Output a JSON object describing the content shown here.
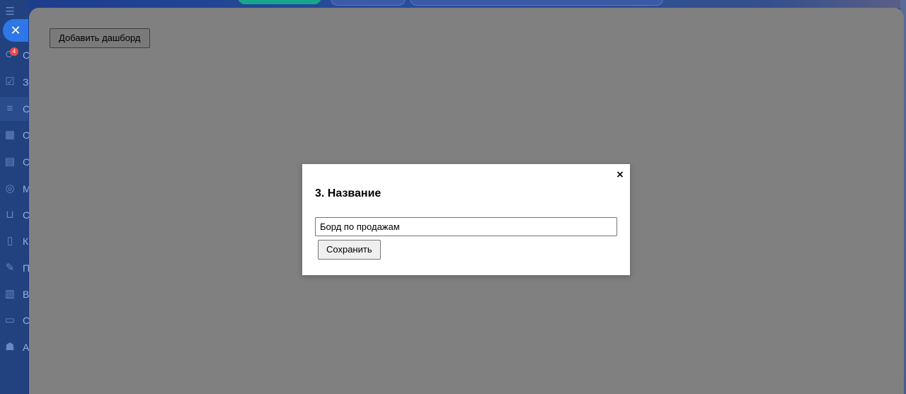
{
  "background_app": {
    "badge_count": "4",
    "sidebar_letters": [
      "С",
      "З",
      "С",
      "О",
      "С",
      "М",
      "С",
      "К",
      "П",
      "В",
      "С",
      "А"
    ],
    "sidebar_icons": [
      "pulse-icon",
      "checkbox-icon",
      "filter-icon",
      "calendar-icon",
      "inbox-icon",
      "target-icon",
      "cart-icon",
      "document-icon",
      "pen-icon",
      "chart-icon",
      "card-icon",
      "robot-icon"
    ]
  },
  "main": {
    "add_dashboard_label": "Добавить дашборд"
  },
  "modal": {
    "title": "3. Название",
    "close_glyph": "×",
    "name_value": "Борд по продажам",
    "save_label": "Сохранить"
  },
  "colors": {
    "overlay": "#808080",
    "modal_bg": "#ffffff",
    "sidebar_bg": "#21427f",
    "accent_blue": "#2f76e8",
    "badge_red": "#e84a4a"
  }
}
